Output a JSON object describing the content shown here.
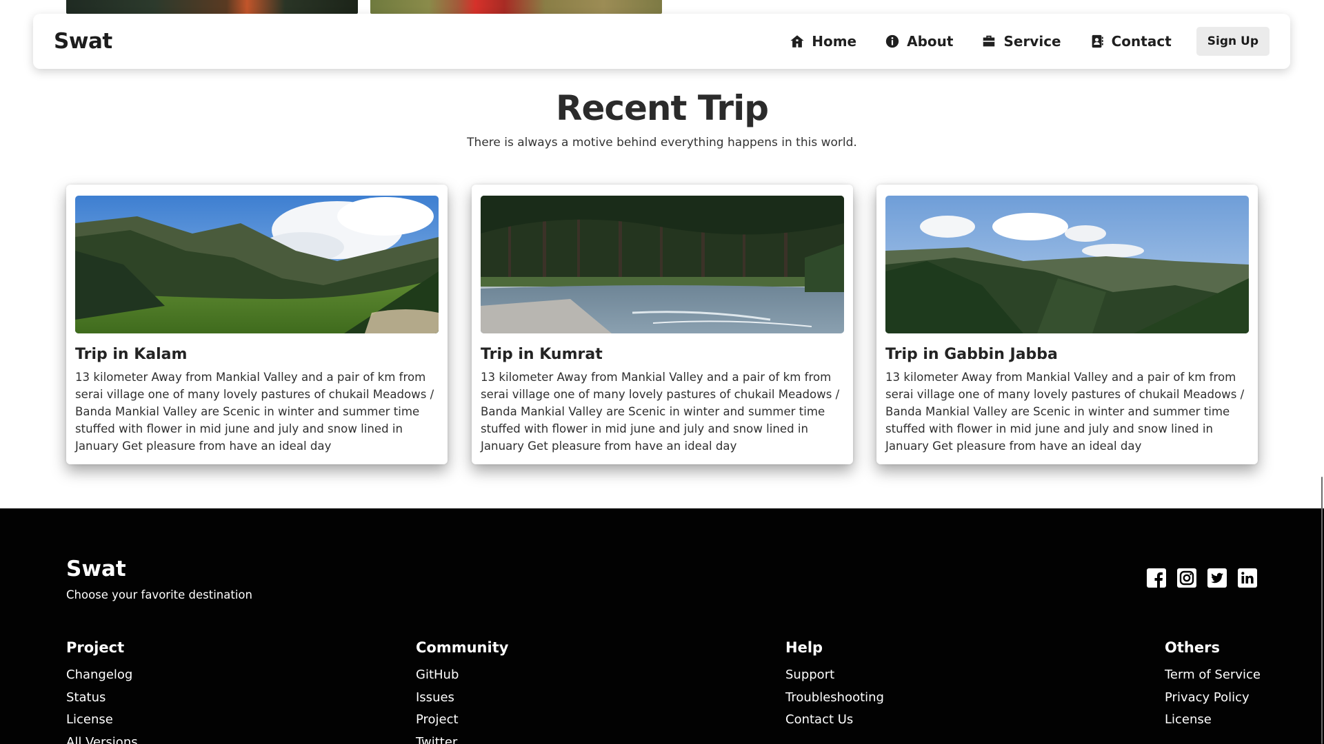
{
  "navbar": {
    "brand": "Swat",
    "links": [
      {
        "label": "Home",
        "icon": "home-icon"
      },
      {
        "label": "About",
        "icon": "info-icon"
      },
      {
        "label": "Service",
        "icon": "briefcase-icon"
      },
      {
        "label": "Contact",
        "icon": "contact-book-icon"
      }
    ],
    "signup_label": "Sign Up"
  },
  "section": {
    "title": "Recent Trip",
    "subtitle": "There is always a motive behind everything happens in this world."
  },
  "cards": [
    {
      "title": "Trip in Kalam",
      "text": "13 kilometer Away from Mankial Valley and a pair of km from serai village one of many lovely pastures of chukail Meadows / Banda Mankial Valley are Scenic in winter and summer time stuffed with flower in mid june and july and snow lined in January Get pleasure from have an ideal day"
    },
    {
      "title": "Trip in Kumrat",
      "text": "13 kilometer Away from Mankial Valley and a pair of km from serai village one of many lovely pastures of chukail Meadows / Banda Mankial Valley are Scenic in winter and summer time stuffed with flower in mid june and july and snow lined in January Get pleasure from have an ideal day"
    },
    {
      "title": "Trip in Gabbin Jabba",
      "text": "13 kilometer Away from Mankial Valley and a pair of km from serai village one of many lovely pastures of chukail Meadows / Banda Mankial Valley are Scenic in winter and summer time stuffed with flower in mid june and july and snow lined in January Get pleasure from have an ideal day"
    }
  ],
  "footer": {
    "brand": "Swat",
    "tagline": "Choose your favorite destination",
    "socials": [
      "facebook-icon",
      "instagram-icon",
      "twitter-icon",
      "linkedin-icon"
    ],
    "columns": [
      {
        "heading": "Project",
        "links": [
          "Changelog",
          "Status",
          "License",
          "All Versions"
        ]
      },
      {
        "heading": "Community",
        "links": [
          "GitHub",
          "Issues",
          "Project",
          "Twitter"
        ]
      },
      {
        "heading": "Help",
        "links": [
          "Support",
          "Troubleshooting",
          "Contact Us"
        ]
      },
      {
        "heading": "Others",
        "links": [
          "Term of Service",
          "Privacy Policy",
          "License"
        ]
      }
    ]
  },
  "colors": {
    "footer_bg": "#020202",
    "signup_bg": "#ebebeb",
    "text_dark": "#222222"
  }
}
